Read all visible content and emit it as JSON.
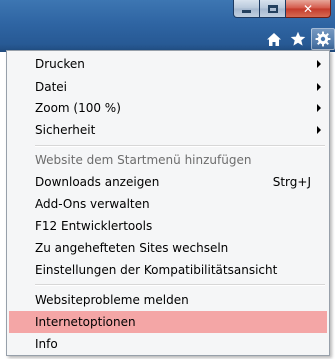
{
  "window_controls": {
    "minimize_icon": "minimize-icon",
    "maximize_icon": "maximize-icon",
    "close_glyph": "✕"
  },
  "command_bar": {
    "home_icon": "home-icon",
    "favorites_icon": "star-icon",
    "tools_icon": "gear-icon"
  },
  "menu": {
    "items": [
      {
        "label": "Drucken",
        "submenu": true
      },
      {
        "label": "Datei",
        "submenu": true
      },
      {
        "label": "Zoom (100 %)",
        "submenu": true
      },
      {
        "label": "Sicherheit",
        "submenu": true
      },
      {
        "label": "Website dem Startmenü hinzufügen",
        "disabled": true
      },
      {
        "label": "Downloads anzeigen",
        "shortcut": "Strg+J"
      },
      {
        "label": "Add-Ons verwalten"
      },
      {
        "label": "F12 Entwicklertools"
      },
      {
        "label": "Zu angehefteten Sites wechseln"
      },
      {
        "label": "Einstellungen der Kompatibilitätsansicht"
      },
      {
        "label": "Websiteprobleme melden"
      },
      {
        "label": "Internetoptionen",
        "highlighted": true
      },
      {
        "label": "Info"
      }
    ]
  },
  "colors": {
    "titlebar": "#2f65a3",
    "menu_background": "#f5f6f7",
    "highlight": "#f4a6a6",
    "disabled_text": "#6d6d6d"
  }
}
